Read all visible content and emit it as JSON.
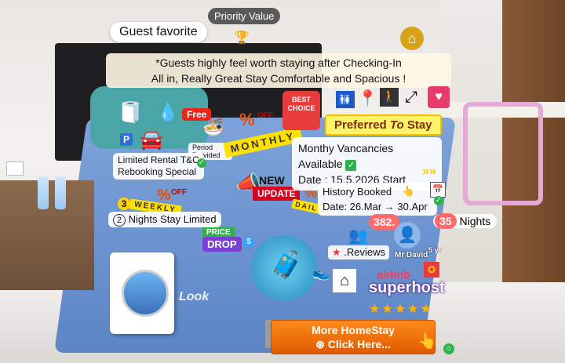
{
  "header": {
    "priority_label": "Priority Value",
    "guest_favorite": "Guest favorite",
    "banner_line1": "*Guests highly feel worth staying after Checking-In",
    "banner_line2": "All in, Really Great Stay Comfortable and Spacious !"
  },
  "promo": {
    "free_tag": "Free",
    "period_label": "Period Provided",
    "monthly_label": "MONTHLY",
    "off_label": "OFF",
    "limited_rental": "Limited Rental T&C",
    "rebooking": "Rebooking Special",
    "new_label": "NEW",
    "update_label": "UPDATE",
    "three_label": "3",
    "two": "2",
    "nights_limited": "Nights Stay Limited",
    "price_label": "PRICE",
    "drop_label": "DROP",
    "daily_label": "DAILY",
    "weekly_label": "WEEKLY"
  },
  "preferred": {
    "best_choice": "BEST CHOICE",
    "title_prefix": "Preferred",
    "title_to": "To",
    "title_suffix": "Stay"
  },
  "vacancy": {
    "line1": "Monthy Vancancies",
    "line2": "Available",
    "line3": "Date : 15.5.2026 Start",
    "arrows": "»»"
  },
  "history": {
    "label": "History Booked",
    "dates": "Date: 26.Mar → 30.Apr",
    "reviews_count": "382.",
    "reviews_label": ".Reviews",
    "nights_count": "35",
    "nights_label": "Nights"
  },
  "host": {
    "name": "Mr David",
    "years": "5 yr",
    "airbnb": "airbnb",
    "superhost": "superhost",
    "stars": "★★★★★"
  },
  "cta": {
    "line1": "More HomeStay",
    "line2": "Click Here..."
  },
  "watermark": "Look"
}
